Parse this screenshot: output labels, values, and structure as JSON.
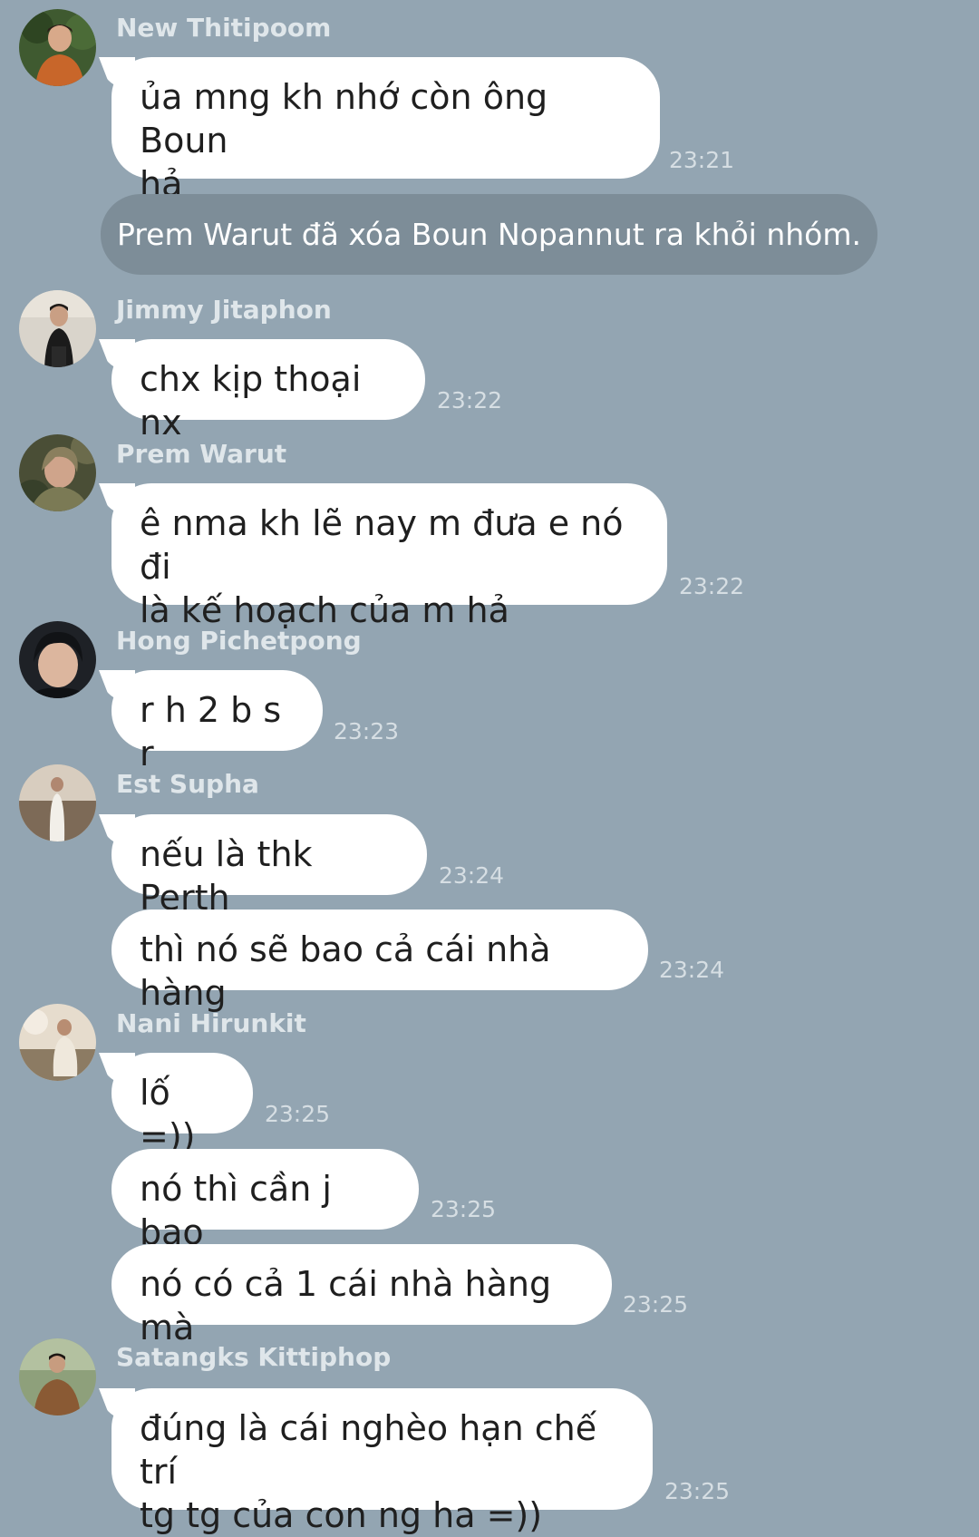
{
  "chat": {
    "messages": [
      {
        "sender": "New Thitipoom",
        "text": "ủa mng kh nhớ còn ông Boun\nhả",
        "time": "23:21"
      },
      {
        "system": "Prem Warut đã xóa Boun Nopannut ra khỏi nhóm."
      },
      {
        "sender": "Jimmy Jitaphon",
        "text": "chx kịp thoại nx",
        "time": "23:22"
      },
      {
        "sender": "Prem Warut",
        "text": "ê nma kh lẽ nay m đưa e nó đi\nlà kế hoạch của m hả",
        "time": "23:22"
      },
      {
        "sender": "Hong Pichetpong",
        "text": "r h 2 b s r",
        "time": "23:23"
      },
      {
        "sender": "Est Supha",
        "text": "nếu là thk Perth",
        "time": "23:24"
      },
      {
        "text": "thì nó sẽ bao cả cái nhà hàng",
        "time": "23:24"
      },
      {
        "sender": "Nani Hirunkit",
        "text": "lố =))",
        "time": "23:25"
      },
      {
        "text": "nó thì cần j bao",
        "time": "23:25"
      },
      {
        "text": "nó có cả 1 cái nhà hàng mà",
        "time": "23:25"
      },
      {
        "sender": "Satangks Kittiphop",
        "text": "đúng là cái nghèo hạn chế trí\ntg tg của con ng ha =))",
        "time": "23:25"
      }
    ]
  },
  "icons": {
    "avatar_1": "user-avatar-icon",
    "avatar_2": "user-avatar-icon",
    "avatar_3": "user-avatar-icon",
    "avatar_4": "user-avatar-icon",
    "avatar_5": "user-avatar-icon",
    "avatar_6": "user-avatar-icon",
    "avatar_7": "user-avatar-icon"
  },
  "colors": {
    "background": "#93a5b2",
    "bubble": "#ffffff",
    "system_bubble": "#7d8d98",
    "sender_name": "#dfe6ea",
    "timestamp": "#d6dee3"
  }
}
